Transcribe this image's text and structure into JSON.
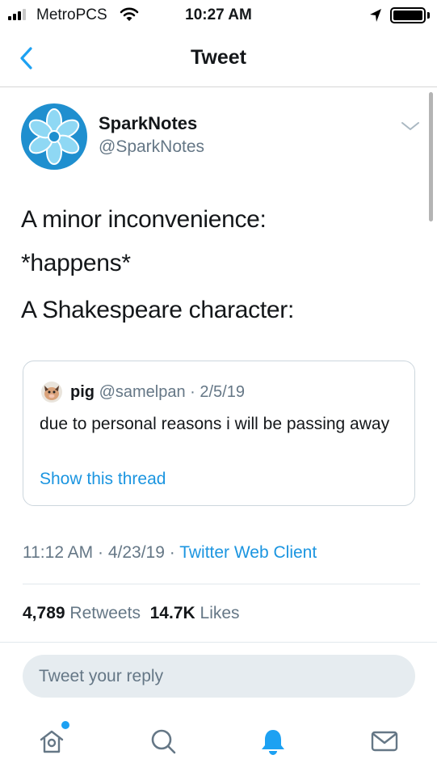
{
  "status_bar": {
    "carrier": "MetroPCS",
    "time": "10:27 AM"
  },
  "nav": {
    "title": "Tweet"
  },
  "tweet": {
    "author_name": "SparkNotes",
    "author_handle": "@SparkNotes",
    "text_lines": [
      "A minor inconvenience:",
      "*happens*",
      "A Shakespeare character:"
    ],
    "quoted": {
      "name": "pig",
      "meta": "@samelpan · 2/5/19",
      "text": "due to personal reasons i will be passing away",
      "link": "Show this thread"
    },
    "meta_time": "11:12 AM · 4/23/19 · ",
    "meta_client": "Twitter Web Client",
    "retweets_count": "4,789",
    "retweets_label": "Retweets",
    "likes_count": "14.7K",
    "likes_label": "Likes"
  },
  "reply": {
    "placeholder": "Tweet your reply"
  },
  "tabbar": {
    "icons": [
      "home-icon",
      "search-icon",
      "notifications-icon",
      "messages-icon"
    ],
    "active": "notifications"
  },
  "colors": {
    "accent": "#1da1f2",
    "link": "#1b95e0",
    "secondary_text": "#657786",
    "avatar_bg": "#1f8fcf"
  }
}
